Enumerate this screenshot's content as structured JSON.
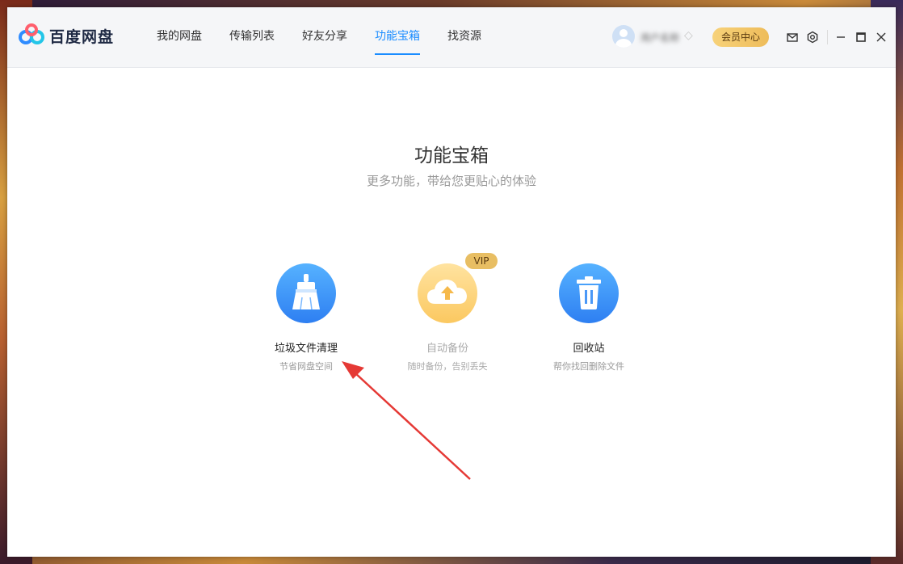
{
  "app": {
    "brand": "百度网盘",
    "username": "用户名称"
  },
  "nav": {
    "items": [
      {
        "label": "我的网盘"
      },
      {
        "label": "传输列表"
      },
      {
        "label": "好友分享"
      },
      {
        "label": "功能宝箱",
        "active": true
      },
      {
        "label": "找资源"
      }
    ]
  },
  "header": {
    "vip_center": "会员中心"
  },
  "main": {
    "title": "功能宝箱",
    "subtitle": "更多功能，带给您更贴心的体验"
  },
  "tools": [
    {
      "name": "垃圾文件清理",
      "desc": "节省网盘空间",
      "icon": "broom-icon"
    },
    {
      "name": "自动备份",
      "desc": "随时备份，告别丢失",
      "icon": "cloud-upload-icon",
      "badge": "VIP"
    },
    {
      "name": "回收站",
      "desc": "帮你找回删除文件",
      "icon": "trash-icon"
    }
  ],
  "colors": {
    "accent": "#1a8cff",
    "vip_gold": "#eebc5a",
    "arrow_red": "#e53935"
  }
}
